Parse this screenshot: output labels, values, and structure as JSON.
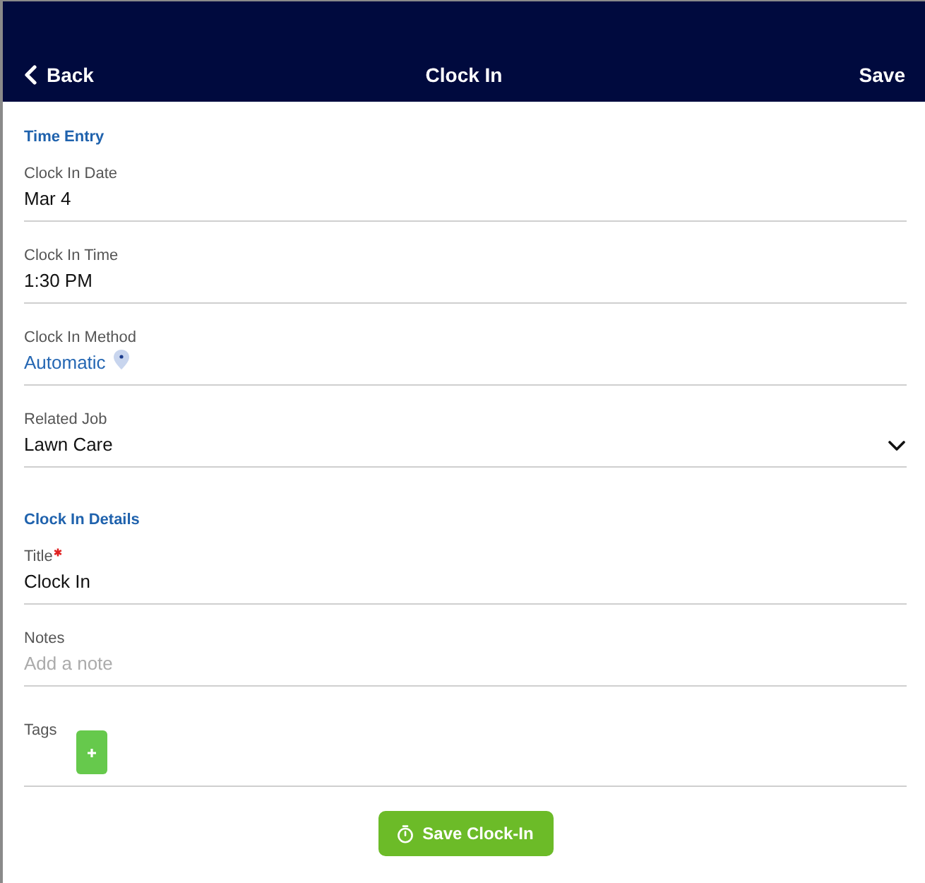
{
  "header": {
    "back": "Back",
    "title": "Clock In",
    "save": "Save"
  },
  "sections": [
    {
      "heading": "Time Entry",
      "fields": [
        {
          "kind": "text",
          "label": "Clock In Date",
          "required": false,
          "value": "Mar 4"
        },
        {
          "kind": "text",
          "label": "Clock In Time",
          "required": false,
          "value": "1:30 PM"
        },
        {
          "kind": "method",
          "label": "Clock In Method",
          "required": false,
          "value": "Automatic"
        },
        {
          "kind": "select",
          "label": "Related Job",
          "required": false,
          "value": "Lawn Care"
        }
      ]
    },
    {
      "heading": "Clock In Details",
      "fields": [
        {
          "kind": "text",
          "label": "Title",
          "required": true,
          "value": "Clock In"
        },
        {
          "kind": "text",
          "label": "Notes",
          "required": false,
          "placeholder": "Add a note"
        },
        {
          "kind": "tags",
          "label": "Tags",
          "required": false
        }
      ]
    }
  ],
  "submit": {
    "label": "Save Clock-In"
  }
}
